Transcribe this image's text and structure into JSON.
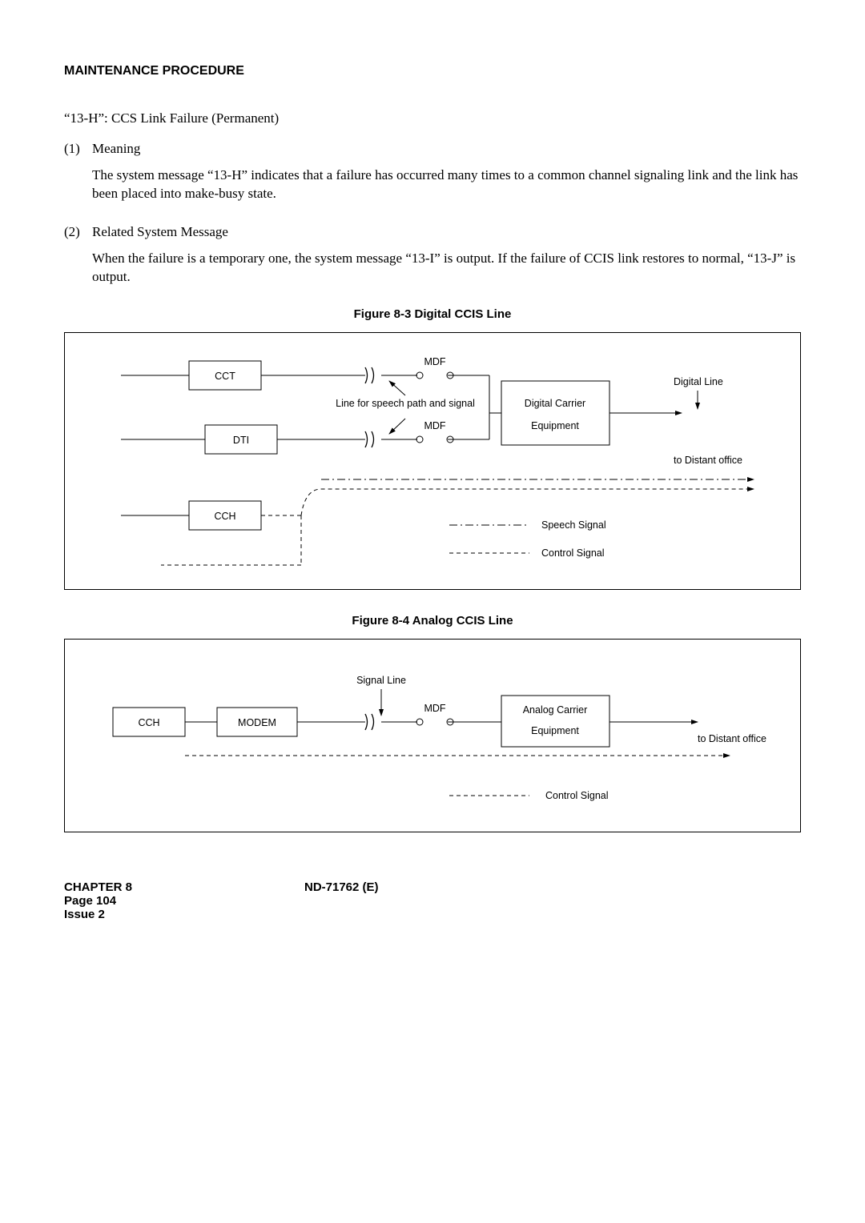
{
  "header": {
    "title": "MAINTENANCE PROCEDURE"
  },
  "intro": "“13-H”: CCS Link Failure (Permanent)",
  "item1": {
    "num": "(1)",
    "label": "Meaning",
    "body": "The system message “13-H” indicates that a failure has occurred many times to a common channel signaling link and the link has been placed into make-busy state."
  },
  "item2": {
    "num": "(2)",
    "label": "Related System Message",
    "body": "When the failure is a temporary one, the system message “13-I” is output. If the failure of CCIS link restores to normal, “13-J” is output."
  },
  "fig83": {
    "caption": "Figure 8-3   Digital CCIS Line",
    "labels": {
      "cct": "CCT",
      "dti": "DTI",
      "cch": "CCH",
      "mdf1": "MDF",
      "mdf2": "MDF",
      "linefor": "Line for speech path and signal",
      "dce": "Digital Carrier",
      "dce2": "Equipment",
      "digline": "Digital Line",
      "todist": "to Distant office",
      "speech": "Speech Signal",
      "control": "Control Signal"
    }
  },
  "fig84": {
    "caption": "Figure 8-4   Analog CCIS Line",
    "labels": {
      "cch": "CCH",
      "modem": "MODEM",
      "sigline": "Signal Line",
      "mdf": "MDF",
      "ace": "Analog Carrier",
      "ace2": "Equipment",
      "todist": "to Distant office",
      "control": "Control Signal"
    }
  },
  "footer": {
    "chapter": "CHAPTER 8",
    "page": "Page 104",
    "issue": "Issue 2",
    "docno": "ND-71762 (E)"
  }
}
